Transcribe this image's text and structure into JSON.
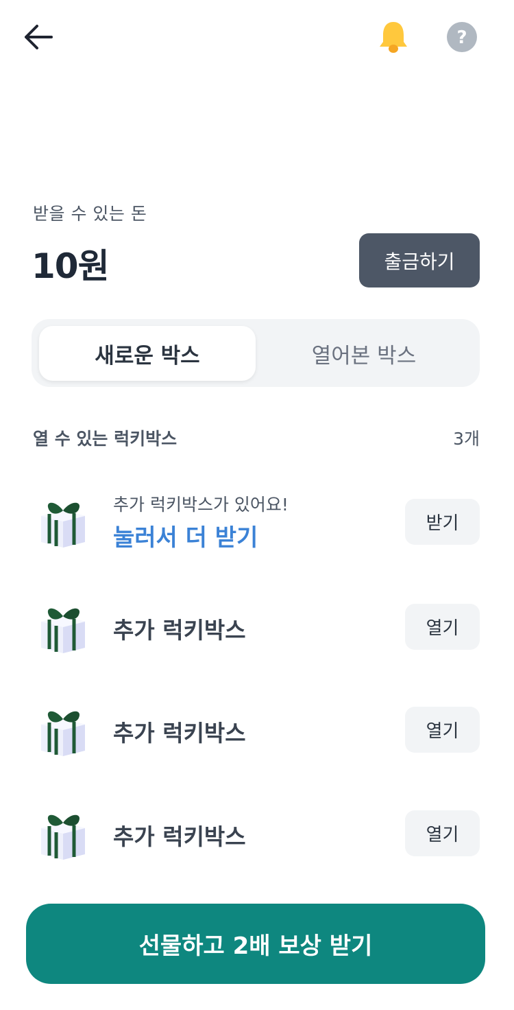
{
  "header": {
    "back_icon": "arrow-left-icon",
    "bell_icon": "bell-icon",
    "help_icon": "question-circle-icon",
    "bell_color": "#FFC83D",
    "help_color": "#B0B8C1"
  },
  "balance": {
    "label": "받을 수 있는 돈",
    "value": "10원",
    "withdraw_label": "출금하기"
  },
  "tabs": [
    {
      "label": "새로운 박스",
      "selected": true
    },
    {
      "label": "열어본 박스",
      "selected": false
    }
  ],
  "section": {
    "title": "열 수 있는 럭키박스",
    "count": "3개"
  },
  "items": [
    {
      "icon": "gift-box-icon",
      "subtitle": "추가 럭키박스가 있어요!",
      "title": "눌러서 더 받기",
      "button": "받기"
    },
    {
      "icon": "gift-box-icon",
      "title": "추가 럭키박스",
      "button": "열기"
    },
    {
      "icon": "gift-box-icon",
      "title": "추가 럭키박스",
      "button": "열기"
    },
    {
      "icon": "gift-box-icon",
      "title": "추가 럭키박스",
      "button": "열기"
    }
  ],
  "cta": {
    "label": "선물하고 2배 보상 받기",
    "color": "#0E877F"
  },
  "colors": {
    "accent_link": "#3B82D6",
    "withdraw_bg": "#4D5766",
    "tab_bg": "#F2F4F6"
  }
}
